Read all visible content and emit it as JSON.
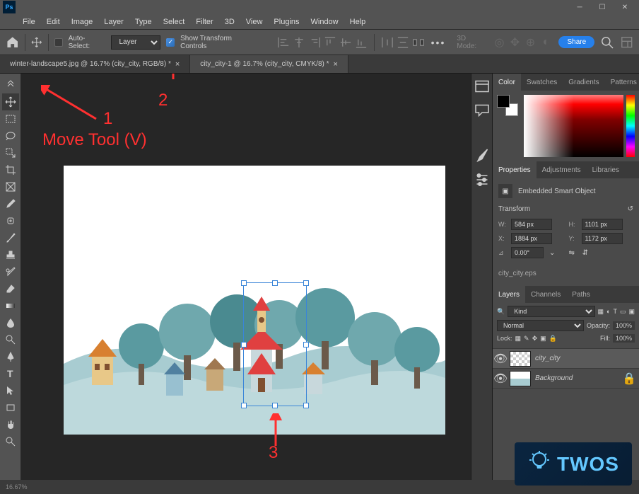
{
  "window": {
    "title": ""
  },
  "menubar": [
    "File",
    "Edit",
    "Image",
    "Layer",
    "Type",
    "Select",
    "Filter",
    "3D",
    "View",
    "Plugins",
    "Window",
    "Help"
  ],
  "optionsbar": {
    "auto_select_label": "Auto-Select:",
    "auto_select_dropdown": "Layer",
    "show_transform_label": "Show Transform Controls",
    "mode_3d_label": "3D Mode:",
    "share_label": "Share"
  },
  "tabs": [
    {
      "label": "winter-landscape5.jpg @ 16.7% (city_city, RGB/8) *"
    },
    {
      "label": "city_city-1 @ 16.7% (city_city, CMYK/8) *"
    }
  ],
  "annotations": {
    "label1": "1",
    "label2": "2",
    "label3": "3",
    "tool_text": "Move Tool (V)"
  },
  "panels": {
    "color": {
      "tabs": [
        "Color",
        "Swatches",
        "Gradients",
        "Patterns"
      ]
    },
    "properties": {
      "tabs": [
        "Properties",
        "Adjustments",
        "Libraries"
      ],
      "object_type": "Embedded Smart Object",
      "transform_label": "Transform",
      "w_label": "W:",
      "w_value": "584 px",
      "h_label": "H:",
      "h_value": "1101 px",
      "x_label": "X:",
      "x_value": "1884 px",
      "y_label": "Y:",
      "y_value": "1172 px",
      "angle_label": "⊿",
      "angle_value": "0.00°",
      "filename": "city_city.eps"
    },
    "layers": {
      "tabs": [
        "Layers",
        "Channels",
        "Paths"
      ],
      "kind_label": "Kind",
      "blend_mode": "Normal",
      "opacity_label": "Opacity:",
      "opacity_value": "100%",
      "lock_label": "Lock:",
      "fill_label": "Fill:",
      "fill_value": "100%",
      "items": [
        {
          "name": "city_city",
          "locked": false
        },
        {
          "name": "Background",
          "locked": true
        }
      ]
    }
  },
  "statusbar": {
    "zoom": "16.67%",
    "info": ""
  },
  "badge": {
    "text": "TWOS"
  }
}
